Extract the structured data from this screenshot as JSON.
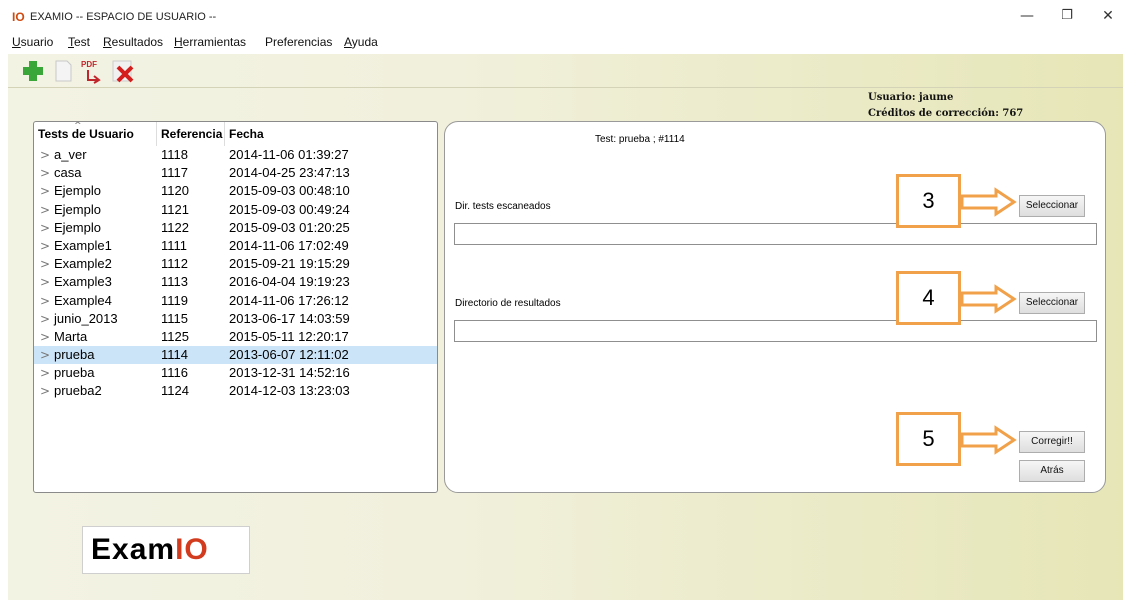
{
  "window": {
    "app_icon": "IO",
    "title": "EXAMIO -- ESPACIO DE USUARIO --",
    "minimize": "—",
    "maximize": "❐",
    "close": "✕"
  },
  "menu": [
    {
      "underline": "U",
      "rest": "suario"
    },
    {
      "underline": "T",
      "rest": "est"
    },
    {
      "underline": "R",
      "rest": "esultados"
    },
    {
      "underline": "H",
      "rest": "erramientas"
    },
    {
      "underline": "",
      "rest": "Preferencias"
    },
    {
      "underline": "A",
      "rest": "yuda",
      "pre": ""
    }
  ],
  "toolbar": {
    "icons": [
      "add-icon",
      "document-icon",
      "export-pdf-icon",
      "delete-icon"
    ],
    "pdf_text": "PDF"
  },
  "user_info": {
    "user": "Usuario: jaume",
    "credits": "Créditos de corrección: 767"
  },
  "tests_table": {
    "columns": [
      "Tests de Usuario",
      "Referencia",
      "Fecha"
    ],
    "rows": [
      {
        "name": "a_ver",
        "ref": "1118",
        "date": "2014-11-06 01:39:27"
      },
      {
        "name": "casa",
        "ref": "1117",
        "date": "2014-04-25 23:47:13"
      },
      {
        "name": "Ejemplo",
        "ref": "1120",
        "date": "2015-09-03 00:48:10"
      },
      {
        "name": "Ejemplo",
        "ref": "1121",
        "date": "2015-09-03 00:49:24"
      },
      {
        "name": "Ejemplo",
        "ref": "1122",
        "date": "2015-09-03 01:20:25"
      },
      {
        "name": "Example1",
        "ref": "1111",
        "date": "2014-11-06 17:02:49"
      },
      {
        "name": "Example2",
        "ref": "1112",
        "date": "2015-09-21 19:15:29"
      },
      {
        "name": "Example3",
        "ref": "1113",
        "date": "2016-04-04 19:19:23"
      },
      {
        "name": "Example4",
        "ref": "1119",
        "date": "2014-11-06 17:26:12"
      },
      {
        "name": "junio_2013",
        "ref": "1115",
        "date": "2013-06-17 14:03:59"
      },
      {
        "name": "Marta",
        "ref": "1125",
        "date": "2015-05-11 12:20:17"
      },
      {
        "name": "prueba",
        "ref": "1114",
        "date": "2013-06-07 12:11:02",
        "selected": true
      },
      {
        "name": "prueba",
        "ref": "1116",
        "date": "2013-12-31 14:52:16"
      },
      {
        "name": "prueba2",
        "ref": "1124",
        "date": "2014-12-03 13:23:03"
      }
    ]
  },
  "detail": {
    "test_label": "Test: prueba ;   #1114",
    "scanned_label": "Dir. tests escaneados",
    "scanned_value": "",
    "scanned_button": "Seleccionar",
    "results_label": "Directorio de resultados",
    "results_value": "",
    "results_button": "Seleccionar",
    "correct_button": "Corregir!!",
    "back_button": "Atrás"
  },
  "callouts": [
    "3",
    "4",
    "5"
  ],
  "logo": {
    "prefix": "Exam",
    "suffix": "IO"
  },
  "colors": {
    "accent_orange": "#f0a14a",
    "selected_row": "#cce4f7",
    "logo_red": "#d23b1e"
  }
}
